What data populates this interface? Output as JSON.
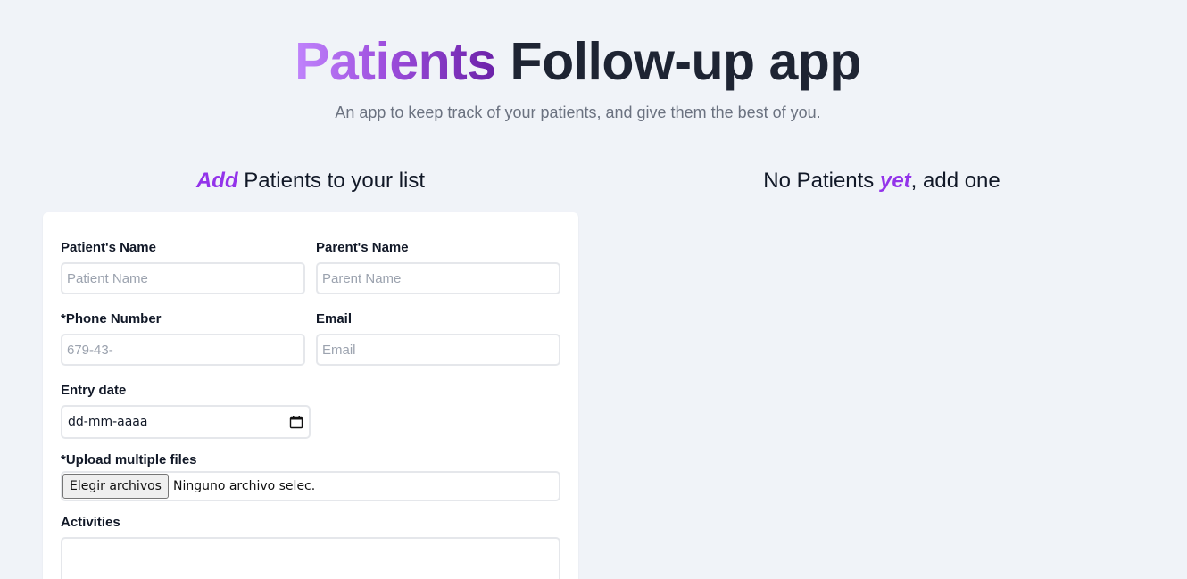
{
  "header": {
    "title_accent": "Patients",
    "title_rest": " Follow-up app",
    "subtitle": "An app to keep track of your patients, and give them the best of you."
  },
  "form_section": {
    "heading_em": "Add",
    "heading_rest": " Patients to your list"
  },
  "list_section": {
    "heading_before": "No Patients ",
    "heading_em": "yet",
    "heading_after": ", add one"
  },
  "form": {
    "patient_name": {
      "label": "Patient's Name",
      "placeholder": "Patient Name",
      "value": ""
    },
    "parent_name": {
      "label": "Parent's Name",
      "placeholder": "Parent Name",
      "value": ""
    },
    "phone": {
      "label": "*Phone Number",
      "placeholder": "679-43-",
      "value": ""
    },
    "email": {
      "label": "Email",
      "placeholder": "Email",
      "value": ""
    },
    "entry_date": {
      "label": "Entry date",
      "value": "dd-mm-aaaa",
      "icon": "calendar-icon"
    },
    "files": {
      "label": "*Upload multiple files",
      "button_label": "Elegir archivos",
      "status": "Ninguno archivo selec."
    },
    "activities": {
      "label": "Activities",
      "value": ""
    }
  },
  "colors": {
    "accent": "#9333ea",
    "background": "#f0f3f8",
    "title": "#1e2433"
  }
}
